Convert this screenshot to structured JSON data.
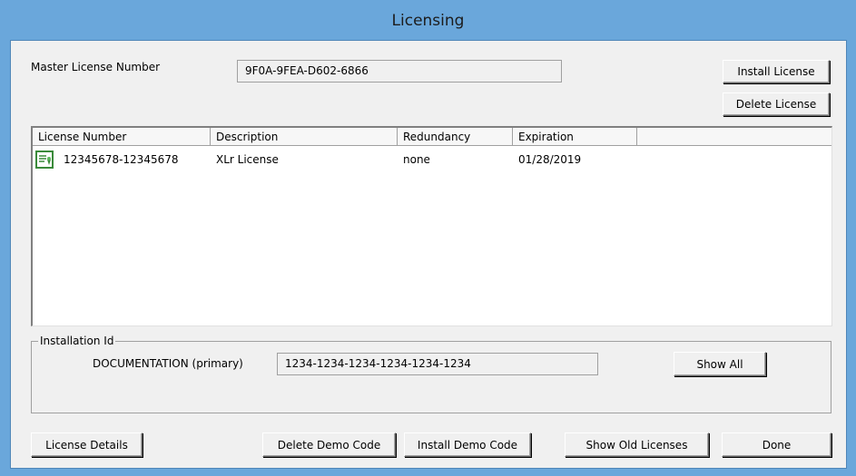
{
  "window": {
    "title": "Licensing"
  },
  "master": {
    "label": "Master License Number",
    "value": "9F0A-9FEA-D602-6866"
  },
  "buttons": {
    "install_license": "Install License",
    "delete_license": "Delete License",
    "show_all": "Show All",
    "license_details": "License Details",
    "delete_demo_code": "Delete Demo Code",
    "install_demo_code": "Install Demo Code",
    "show_old_licenses": "Show Old Licenses",
    "done": "Done"
  },
  "license_list": {
    "columns": [
      "License Number",
      "Description",
      "Redundancy",
      "Expiration"
    ],
    "rows": [
      {
        "icon": "license-certificate-icon",
        "license_number": "12345678-12345678",
        "description": "XLr License",
        "redundancy": "none",
        "expiration": "01/28/2019"
      }
    ]
  },
  "installation": {
    "group_label": "Installation Id",
    "computer_label": "DOCUMENTATION (primary)",
    "id_value": "1234-1234-1234-1234-1234-1234"
  }
}
